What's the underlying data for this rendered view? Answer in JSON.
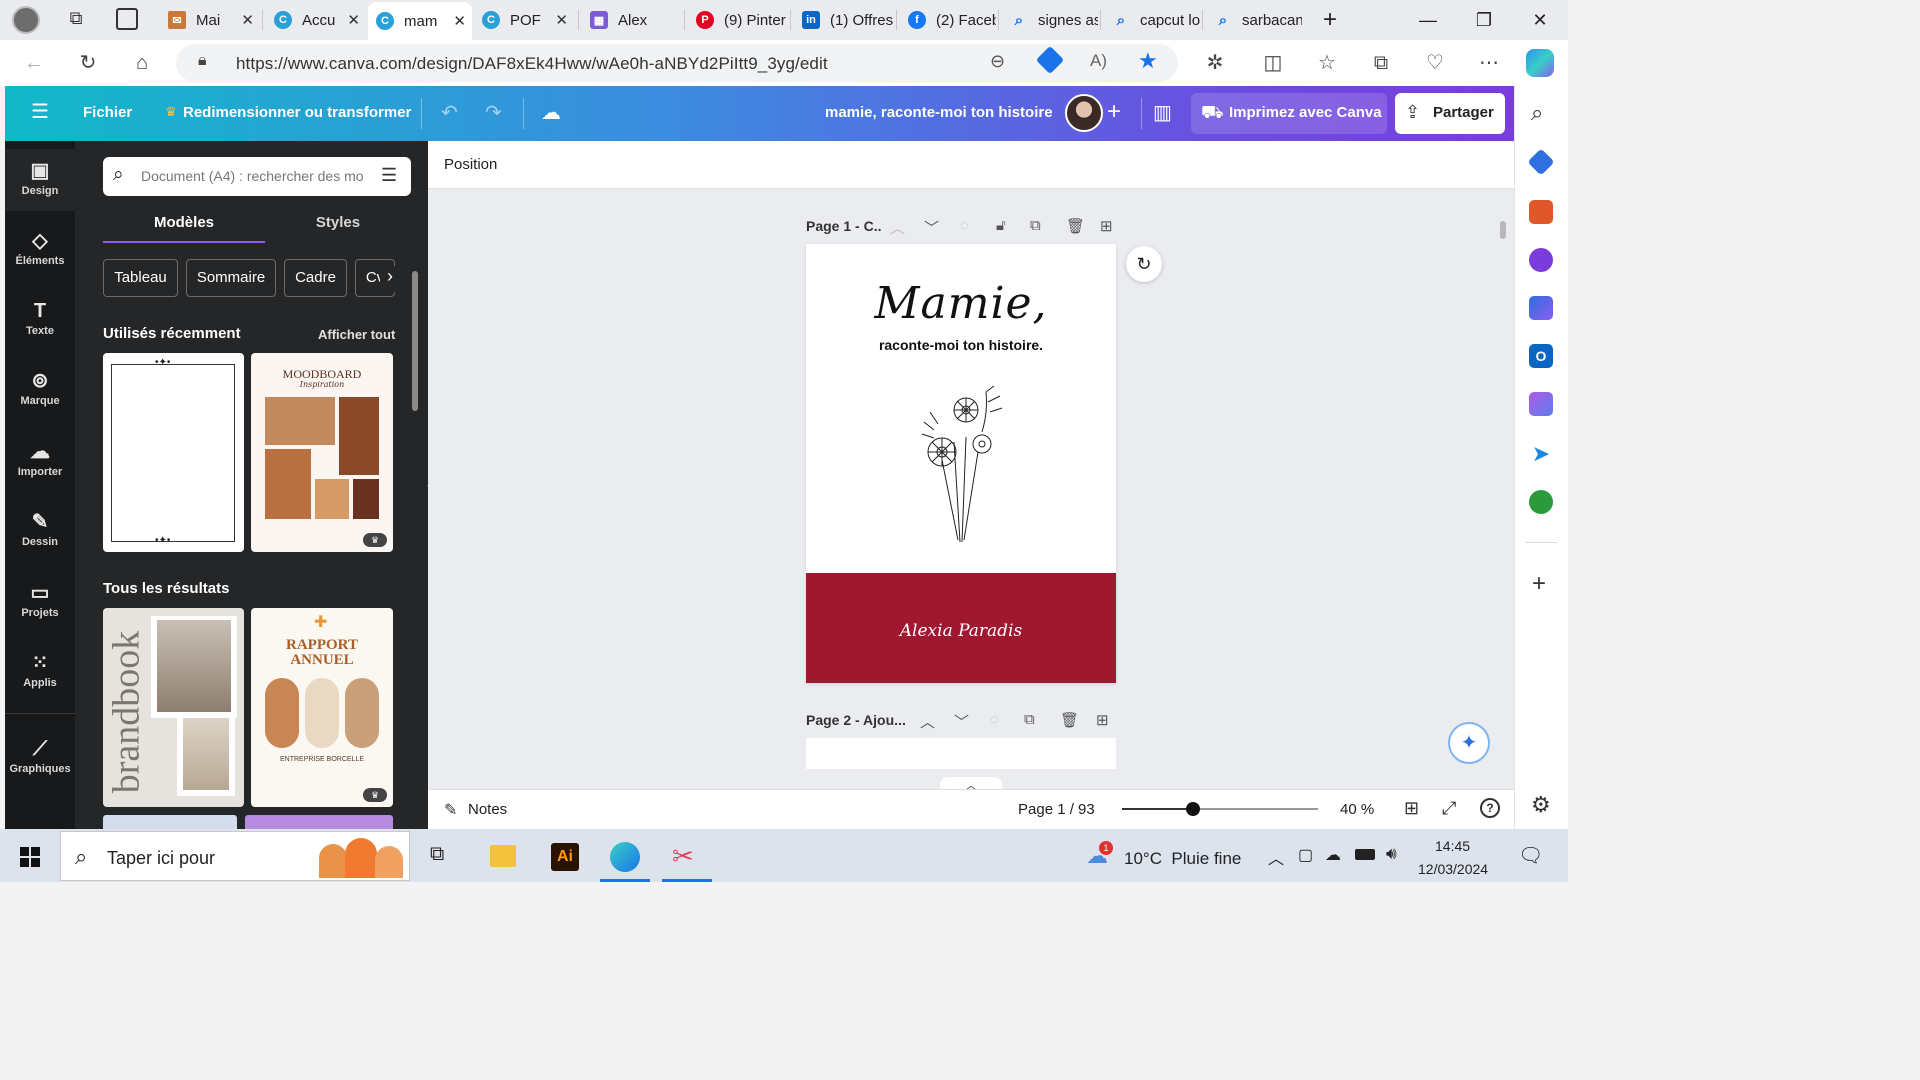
{
  "browser": {
    "tabs": [
      {
        "label": "Mai",
        "icon": "mail-icon",
        "color": "#c97a3a"
      },
      {
        "label": "Accu",
        "icon": "canva-icon",
        "color": "#2aa0d8"
      },
      {
        "label": "mam",
        "icon": "canva-icon",
        "color": "#2aa0d8"
      },
      {
        "label": "POF",
        "icon": "canva-icon",
        "color": "#2aa0d8"
      },
      {
        "label": "Alex",
        "icon": "calendar-icon",
        "color": "#7b5cd6"
      },
      {
        "label": "(9) Pinter",
        "icon": "pinterest-icon",
        "color": "#e60023"
      },
      {
        "label": "(1) Offres",
        "icon": "linkedin-icon",
        "color": "#0a66c2"
      },
      {
        "label": "(2) Faceb",
        "icon": "facebook-icon",
        "color": "#1877f2"
      },
      {
        "label": "signes as",
        "icon": "search-icon",
        "color": "#1a73e8"
      },
      {
        "label": "capcut lo",
        "icon": "search-icon",
        "color": "#1a73e8"
      },
      {
        "label": "sarbacan",
        "icon": "search-icon",
        "color": "#1a73e8"
      }
    ],
    "url": "https://www.canva.com/design/DAF8xEk4Hww/wAe0h-aNBYd2PiItt9_3yg/edit"
  },
  "canva_header": {
    "menu_file": "Fichier",
    "resize": "Redimensionner ou transformer",
    "doc_title": "mamie, raconte-moi ton histoire",
    "print": "Imprimez avec Canva",
    "share": "Partager"
  },
  "rail": [
    {
      "label": "Design",
      "icon": "design-icon"
    },
    {
      "label": "Éléments",
      "icon": "elements-icon"
    },
    {
      "label": "Texte",
      "icon": "text-icon"
    },
    {
      "label": "Marque",
      "icon": "brand-icon"
    },
    {
      "label": "Importer",
      "icon": "upload-icon"
    },
    {
      "label": "Dessin",
      "icon": "draw-icon"
    },
    {
      "label": "Projets",
      "icon": "folder-icon"
    },
    {
      "label": "Applis",
      "icon": "apps-icon"
    },
    {
      "label": "Graphiques",
      "icon": "chart-icon"
    }
  ],
  "panel": {
    "search_placeholder": "Document (A4) : rechercher des mo",
    "tabs": [
      "Modèles",
      "Styles"
    ],
    "chips": [
      "Tableau",
      "Sommaire",
      "Cadre",
      "Cv"
    ],
    "recent_title": "Utilisés récemment",
    "see_all": "Afficher tout",
    "all_results_title": "Tous les résultats",
    "moodboard_title": "MOODBOARD",
    "moodboard_subtitle": "Inspiration",
    "brandbook_word": "brandbook",
    "rapport_title": "RAPPORT ANNUEL",
    "rapport_company": "ENTREPRISE BORCELLE"
  },
  "editor": {
    "position_label": "Position",
    "page1_label": "Page 1 - C..",
    "page2_label": "Page 2 - Ajou...",
    "cover_title": "Mamie,",
    "cover_subtitle": "raconte-moi ton histoire.",
    "cover_author": "Alexia Paradis",
    "accent_color": "#a01830",
    "notes": "Notes",
    "page_counter": "Page 1 / 93",
    "zoom": "40 %",
    "zoom_level_fraction": 0.4
  },
  "taskbar": {
    "search_placeholder": "Taper ici pour",
    "weather": "10°C  Pluie fine",
    "time": "14:45",
    "date": "12/03/2024"
  }
}
